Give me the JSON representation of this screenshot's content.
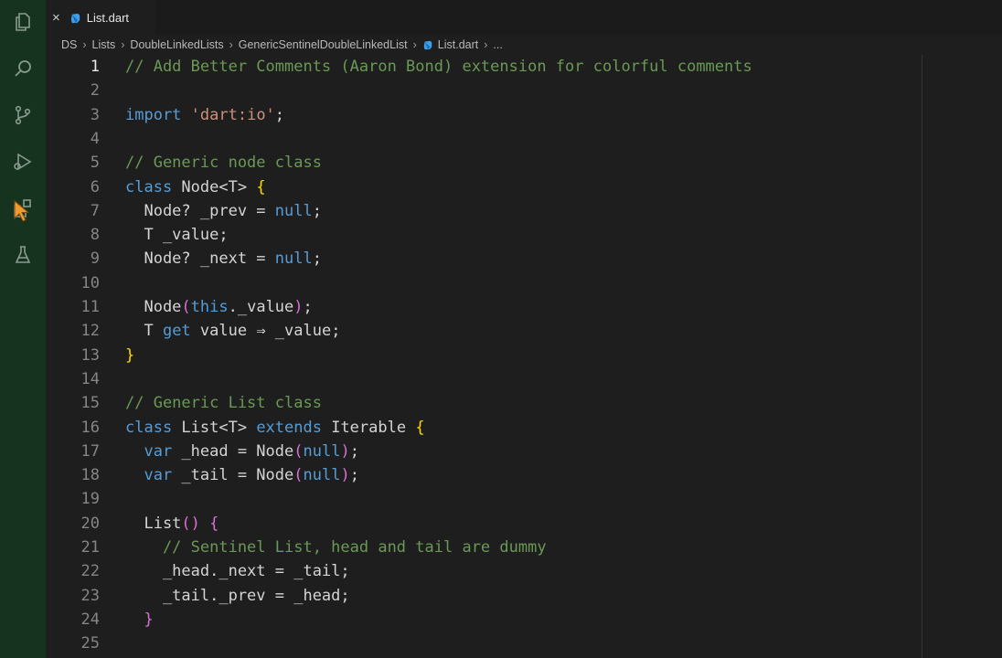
{
  "activity_bar": {
    "icons": [
      "explorer-icon",
      "search-icon",
      "source-control-icon",
      "run-debug-icon",
      "extensions-icon",
      "testing-icon"
    ]
  },
  "tab": {
    "label": "List.dart",
    "close": "×"
  },
  "breadcrumb": [
    "DS",
    "Lists",
    "DoubleLinkedLists",
    "GenericSentinelDoubleLinkedList",
    "List.dart",
    "..."
  ],
  "editor": {
    "active_line": 1,
    "lines": [
      {
        "n": "1",
        "tokens": [
          [
            "cm",
            "// Add Better Comments (Aaron Bond) extension for colorful comments"
          ]
        ]
      },
      {
        "n": "2",
        "tokens": []
      },
      {
        "n": "3",
        "tokens": [
          [
            "kw",
            "import"
          ],
          [
            "id",
            " "
          ],
          [
            "str",
            "'dart:io'"
          ],
          [
            "id",
            ";"
          ]
        ]
      },
      {
        "n": "4",
        "tokens": []
      },
      {
        "n": "5",
        "tokens": [
          [
            "cm",
            "// Generic node class"
          ]
        ]
      },
      {
        "n": "6",
        "tokens": [
          [
            "kw",
            "class"
          ],
          [
            "id",
            " Node<T> "
          ],
          [
            "yb",
            "{"
          ]
        ]
      },
      {
        "n": "7",
        "tokens": [
          [
            "id",
            "  Node? _prev = "
          ],
          [
            "kw",
            "null"
          ],
          [
            "id",
            ";"
          ]
        ]
      },
      {
        "n": "8",
        "tokens": [
          [
            "id",
            "  T _value;"
          ]
        ]
      },
      {
        "n": "9",
        "tokens": [
          [
            "id",
            "  Node? _next = "
          ],
          [
            "kw",
            "null"
          ],
          [
            "id",
            ";"
          ]
        ]
      },
      {
        "n": "10",
        "tokens": []
      },
      {
        "n": "11",
        "tokens": [
          [
            "id",
            "  Node"
          ],
          [
            "pb",
            "("
          ],
          [
            "kw",
            "this"
          ],
          [
            "id",
            "._value"
          ],
          [
            "pb",
            ")"
          ],
          [
            "id",
            ";"
          ]
        ]
      },
      {
        "n": "12",
        "tokens": [
          [
            "id",
            "  T "
          ],
          [
            "kw",
            "get"
          ],
          [
            "id",
            " value ⇒ _value;"
          ]
        ]
      },
      {
        "n": "13",
        "tokens": [
          [
            "yb",
            "}"
          ]
        ]
      },
      {
        "n": "14",
        "tokens": []
      },
      {
        "n": "15",
        "tokens": [
          [
            "cm",
            "// Generic List class"
          ]
        ]
      },
      {
        "n": "16",
        "tokens": [
          [
            "kw",
            "class"
          ],
          [
            "id",
            " List<T> "
          ],
          [
            "kw",
            "extends"
          ],
          [
            "id",
            " Iterable "
          ],
          [
            "yb",
            "{"
          ]
        ]
      },
      {
        "n": "17",
        "tokens": [
          [
            "kw",
            "  var"
          ],
          [
            "id",
            " _head = Node"
          ],
          [
            "pb",
            "("
          ],
          [
            "kw",
            "null"
          ],
          [
            "pb",
            ")"
          ],
          [
            "id",
            ";"
          ]
        ]
      },
      {
        "n": "18",
        "tokens": [
          [
            "kw",
            "  var"
          ],
          [
            "id",
            " _tail = Node"
          ],
          [
            "pb",
            "("
          ],
          [
            "kw",
            "null"
          ],
          [
            "pb",
            ")"
          ],
          [
            "id",
            ";"
          ]
        ]
      },
      {
        "n": "19",
        "tokens": []
      },
      {
        "n": "20",
        "tokens": [
          [
            "id",
            "  List"
          ],
          [
            "pb",
            "()"
          ],
          [
            "id",
            " "
          ],
          [
            "pb",
            "{"
          ]
        ]
      },
      {
        "n": "21",
        "tokens": [
          [
            "cm",
            "    // Sentinel List, head and tail are dummy"
          ]
        ]
      },
      {
        "n": "22",
        "tokens": [
          [
            "id",
            "    _head._next = _tail;"
          ]
        ]
      },
      {
        "n": "23",
        "tokens": [
          [
            "id",
            "    _tail._prev = _head;"
          ]
        ]
      },
      {
        "n": "24",
        "tokens": [
          [
            "pb",
            "  }"
          ]
        ]
      },
      {
        "n": "25",
        "tokens": []
      }
    ]
  }
}
